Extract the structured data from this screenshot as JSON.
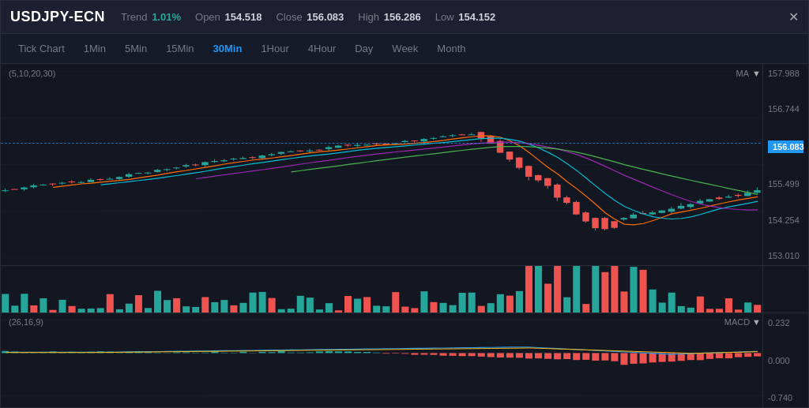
{
  "header": {
    "symbol": "USDJPY-ECN",
    "trend_label": "Trend",
    "trend_value": "1.01%",
    "open_label": "Open",
    "open_value": "154.518",
    "close_label": "Close",
    "close_value": "156.083",
    "high_label": "High",
    "high_value": "156.286",
    "low_label": "Low",
    "low_value": "154.152"
  },
  "timeframes": [
    {
      "id": "tick",
      "label": "Tick Chart",
      "active": false
    },
    {
      "id": "1min",
      "label": "1Min",
      "active": false
    },
    {
      "id": "5min",
      "label": "5Min",
      "active": false
    },
    {
      "id": "15min",
      "label": "15Min",
      "active": false
    },
    {
      "id": "30min",
      "label": "30Min",
      "active": true
    },
    {
      "id": "1hour",
      "label": "1Hour",
      "active": false
    },
    {
      "id": "4hour",
      "label": "4Hour",
      "active": false
    },
    {
      "id": "day",
      "label": "Day",
      "active": false
    },
    {
      "id": "week",
      "label": "Week",
      "active": false
    },
    {
      "id": "month",
      "label": "Month",
      "active": false
    }
  ],
  "chart": {
    "ma_params": "(5,10,20,30)",
    "ma_label": "MA",
    "price_levels": [
      "157.988",
      "156.744",
      "155.499",
      "154.254",
      "153.010"
    ],
    "current_price": "156.083",
    "dashed_line_pct": 42
  },
  "macd": {
    "params": "(26,16,9)",
    "label": "MACD",
    "levels": [
      "0.232",
      "0.000",
      "-0.740"
    ]
  }
}
